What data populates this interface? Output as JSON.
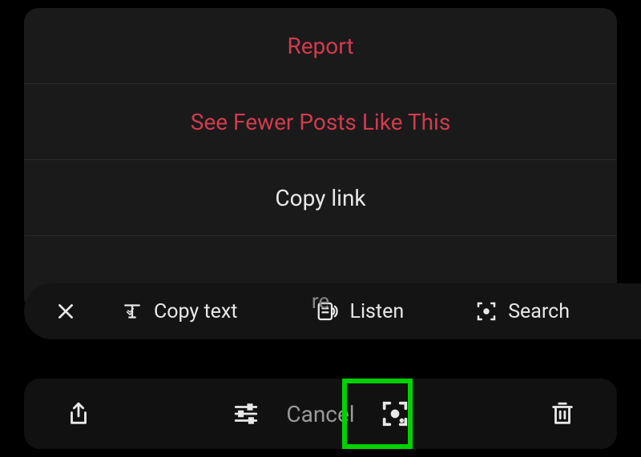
{
  "sheet": {
    "report": "Report",
    "see_fewer": "See Fewer Posts Like This",
    "copy_link": "Copy link",
    "share_to_partial": "re"
  },
  "text_bar": {
    "copy_text": "Copy text",
    "listen": "Listen",
    "search": "Search"
  },
  "bottom": {
    "cancel": "Cancel"
  },
  "colors": {
    "destructive": "#d13b4e",
    "highlight": "#00d200"
  }
}
